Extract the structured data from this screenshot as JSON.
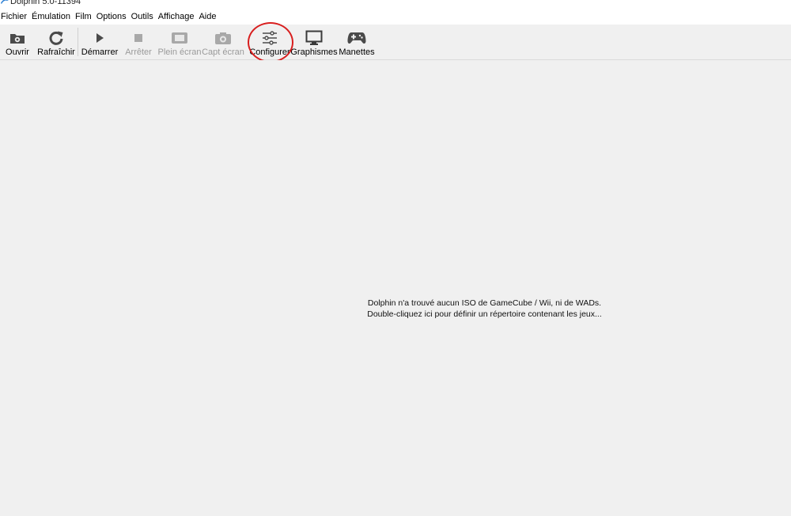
{
  "window": {
    "title": "Dolphin 5.0-11394"
  },
  "menu": {
    "items": [
      {
        "label": "Fichier"
      },
      {
        "label": "Émulation"
      },
      {
        "label": "Film"
      },
      {
        "label": "Options"
      },
      {
        "label": "Outils"
      },
      {
        "label": "Affichage"
      },
      {
        "label": "Aide"
      }
    ]
  },
  "toolbar": {
    "open": {
      "label": "Ouvrir",
      "icon": "folder-icon",
      "enabled": true
    },
    "refresh": {
      "label": "Rafraîchir",
      "icon": "refresh-icon",
      "enabled": true
    },
    "play": {
      "label": "Démarrer",
      "icon": "play-icon",
      "enabled": true
    },
    "stop": {
      "label": "Arrêter",
      "icon": "stop-icon",
      "enabled": false
    },
    "fullscreen": {
      "label": "Plein écran",
      "icon": "fullscreen-icon",
      "enabled": false
    },
    "screenshot": {
      "label": "Capt écran",
      "icon": "camera-icon",
      "enabled": false
    },
    "configure": {
      "label": "Configurer",
      "icon": "sliders-icon",
      "enabled": true,
      "highlighted": true
    },
    "graphics": {
      "label": "Graphismes",
      "icon": "monitor-icon",
      "enabled": true
    },
    "controllers": {
      "label": "Manettes",
      "icon": "gamepad-icon",
      "enabled": true
    }
  },
  "game_list": {
    "empty_line1": "Dolphin n'a trouvé aucun ISO de GameCube / Wii, ni de WADs.",
    "empty_line2": "Double-cliquez ici pour définir un répertoire contenant les jeux..."
  },
  "colors": {
    "highlight_ring": "#d81e1e",
    "icon": "#4a4a4a",
    "icon_disabled": "#a8a8a8"
  }
}
